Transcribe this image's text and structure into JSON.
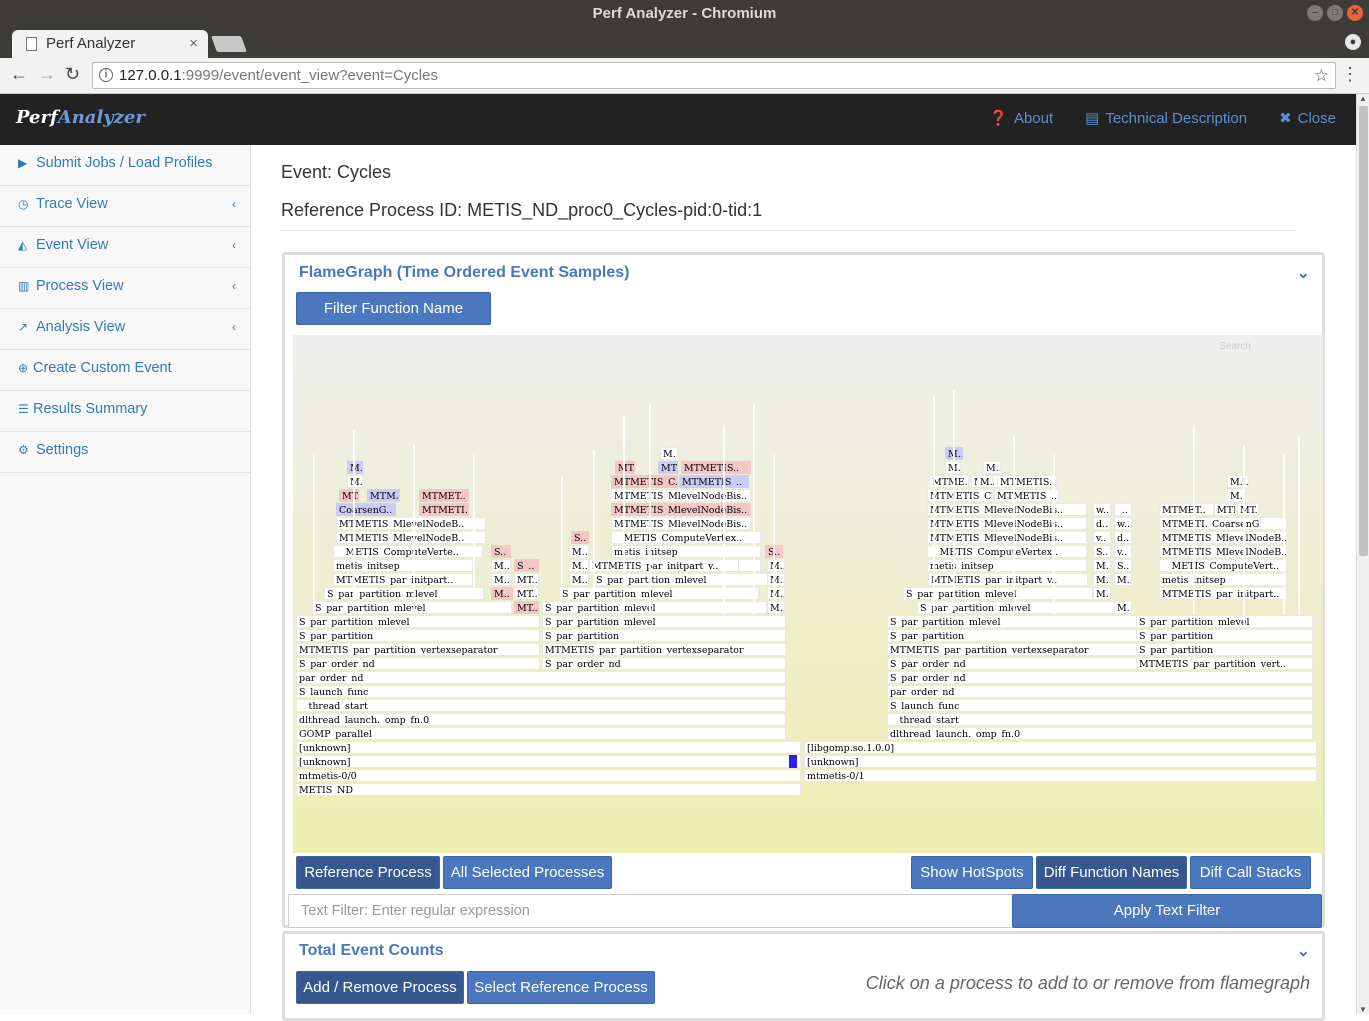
{
  "window": {
    "title": "Perf Analyzer - Chromium"
  },
  "browser": {
    "tab_title": "Perf Analyzer",
    "url_host": "127.0.0.1",
    "url_rest": ":9999/event/event_view?event=Cycles"
  },
  "navbar": {
    "brand_part1": "Perf",
    "brand_part2": "Analyzer",
    "about": "About",
    "tech": "Technical Description",
    "close": "Close"
  },
  "sidebar": {
    "items": [
      {
        "label": "Submit Jobs / Load Profiles",
        "icon": "play-icon"
      },
      {
        "label": "Trace View",
        "icon": "clock-icon"
      },
      {
        "label": "Event View",
        "icon": "area-chart-icon"
      },
      {
        "label": "Process View",
        "icon": "bar-chart-icon"
      },
      {
        "label": "Analysis View",
        "icon": "line-chart-icon"
      },
      {
        "label": "Create Custom Event",
        "icon": "plus-circle-icon"
      },
      {
        "label": "Results Summary",
        "icon": "list-icon"
      },
      {
        "label": "Settings",
        "icon": "gear-icon"
      }
    ]
  },
  "main": {
    "event_title": "Event: Cycles",
    "ref_title": "Reference Process ID: METIS_ND_proc0_Cycles-pid:0-tid:1"
  },
  "flame_panel": {
    "title": "FlameGraph (Time Ordered Event Samples)",
    "filter_button": "Filter Function Name",
    "search_label": "Search",
    "ref_button": "Reference Process",
    "all_button": "All Selected Processes",
    "hotspots_button": "Show HotSpots",
    "diff_names_button": "Diff Function Names",
    "diff_stacks_button": "Diff Call Stacks",
    "text_filter_placeholder": "Text Filter: Enter regular expression",
    "apply_button": "Apply Text Filter"
  },
  "counts_panel": {
    "title": "Total Event Counts",
    "add_button": "Add / Remove Process",
    "select_button": "Select Reference Process",
    "hint": "Click on a process to add to or remove from flamegraph"
  },
  "flame_frames": [
    {
      "t": "METIS_ND",
      "c": "w"
    },
    {
      "t": "mtmetis-0/0",
      "c": "w"
    },
    {
      "t": "mtmetis-0/1",
      "c": "w"
    },
    {
      "t": "[unknown]",
      "c": "w"
    },
    {
      "t": "[unknown]",
      "c": "w"
    },
    {
      "t": "[unknown]",
      "c": "w"
    },
    {
      "t": "[libgomp.so.1.0.0]",
      "c": "w"
    },
    {
      "t": "GOMP_parallel",
      "c": "w"
    },
    {
      "t": "dlthread_launch._omp_fn.0",
      "c": "w"
    },
    {
      "t": "dlthread_launch._omp_fn.0",
      "c": "w"
    },
    {
      "t": "__thread_start",
      "c": "w"
    },
    {
      "t": "__thread_start",
      "c": "w"
    },
    {
      "t": "S_launch_func",
      "c": "w"
    },
    {
      "t": "S_launch_func",
      "c": "w"
    },
    {
      "t": "par_order_nd",
      "c": "w"
    },
    {
      "t": "S_par_order_nd",
      "c": "w"
    },
    {
      "t": "S_par_order_nd",
      "c": "w"
    },
    {
      "t": "S_par_order_nd",
      "c": "w"
    },
    {
      "t": "S_par_order_nd",
      "c": "w"
    },
    {
      "t": "par_order_nd",
      "c": "w"
    },
    {
      "t": "MTMETIS_par_partition_vertexseparator",
      "c": "w"
    },
    {
      "t": "MTMETIS_par_partition_vertexseparator",
      "c": "w"
    },
    {
      "t": "MTMETIS_par_partition_vertexseparator",
      "c": "w"
    },
    {
      "t": "MTMETIS_par_partition_vert..",
      "c": "w"
    },
    {
      "t": "S_par_partition",
      "c": "w"
    },
    {
      "t": "S_par_partition",
      "c": "w"
    },
    {
      "t": "S_par_partition",
      "c": "w"
    },
    {
      "t": "S_par_partition",
      "c": "w"
    },
    {
      "t": "S_par_partition_mlevel",
      "c": "w"
    },
    {
      "t": "S_par_partition",
      "c": "w"
    },
    {
      "t": "S_par_partition_mlevel",
      "c": "w"
    },
    {
      "t": "S_par_partition_mlevel",
      "c": "w"
    },
    {
      "t": "S_par_partition_mlevel",
      "c": "w"
    },
    {
      "t": "MT..",
      "c": "p"
    },
    {
      "t": "S_par_partition_mlevel",
      "c": "w"
    },
    {
      "t": "S_par_partition_mlevel",
      "c": "w"
    },
    {
      "t": "M..",
      "c": "w"
    },
    {
      "t": "S_par_partition_mlevel",
      "c": "w"
    },
    {
      "t": "S_par_partition_mlevel",
      "c": "w"
    },
    {
      "t": "M..",
      "c": "p"
    },
    {
      "t": "MT..",
      "c": "w"
    },
    {
      "t": "S_par_partition_mlevel",
      "c": "w"
    },
    {
      "t": "M..",
      "c": "w"
    },
    {
      "t": "S_par_partition_mlevel",
      "c": "w"
    },
    {
      "t": "M..",
      "c": "w"
    },
    {
      "t": "M..",
      "c": "w"
    },
    {
      "t": "MTMETIS_par_initpart..",
      "c": "w"
    },
    {
      "t": "M..",
      "c": "w"
    },
    {
      "t": "MT..",
      "c": "w"
    },
    {
      "t": "M..",
      "c": "w"
    },
    {
      "t": "S_par_partition_mlevel",
      "c": "w"
    },
    {
      "t": "M..",
      "c": "w"
    },
    {
      "t": "M..",
      "c": "w"
    },
    {
      "t": "MTMETIS_par_initpart_v..",
      "c": "w"
    },
    {
      "t": "M..",
      "c": "w"
    },
    {
      "t": "MTMETIS_par_initpart..",
      "c": "w"
    },
    {
      "t": "metis_initsep",
      "c": "w"
    },
    {
      "t": "M..",
      "c": "w"
    },
    {
      "t": "S_..",
      "c": "p"
    },
    {
      "t": "M..",
      "c": "w"
    },
    {
      "t": "metis_initsep",
      "c": "w"
    },
    {
      "t": "MTMETIS_par_initpart_v..",
      "c": "w"
    },
    {
      "t": "M..",
      "c": "w"
    },
    {
      "t": "metis_initsep",
      "c": "w"
    },
    {
      "t": "M..",
      "c": "w"
    },
    {
      "t": "S..",
      "c": "w"
    },
    {
      "t": "metis_initsep",
      "c": "w"
    },
    {
      "t": "__METIS_ComputeVerte..",
      "c": "w"
    },
    {
      "t": "S..",
      "c": "p"
    },
    {
      "t": "M..",
      "c": "w"
    },
    {
      "t": "metis_initsep",
      "c": "w"
    },
    {
      "t": "S..",
      "c": "p"
    },
    {
      "t": "__METIS_ComputeVertex..",
      "c": "w"
    },
    {
      "t": "S..",
      "c": "w"
    },
    {
      "t": "v..",
      "c": "w"
    },
    {
      "t": "__METIS_ComputeVert..",
      "c": "w"
    },
    {
      "t": "MTMETIS_MlevelNodeB..",
      "c": "w"
    },
    {
      "t": "S..",
      "c": "p"
    },
    {
      "t": "__METIS_ComputeVertex..",
      "c": "w"
    },
    {
      "t": "MTMETIS_MlevelNodeBis..",
      "c": "w"
    },
    {
      "t": "v..",
      "c": "w"
    },
    {
      "t": "d..",
      "c": "w"
    },
    {
      "t": "MTMETIS_MlevelNodeB..",
      "c": "w"
    },
    {
      "t": "MTMETIS_MlevelNodeB..",
      "c": "w"
    },
    {
      "t": "MTMETIS_MlevelNodeBis..",
      "c": "w"
    },
    {
      "t": "MTMETIS_MlevelNodeBis..",
      "c": "w"
    },
    {
      "t": "d..",
      "c": "w"
    },
    {
      "t": "w..",
      "c": "w"
    },
    {
      "t": "MTMETIS_MlevelNodeB..",
      "c": "w"
    },
    {
      "t": "CoarsenG..",
      "c": "l"
    },
    {
      "t": "MTMETI..",
      "c": "p"
    },
    {
      "t": "MTMETIS_MlevelNodeBis..",
      "c": "p"
    },
    {
      "t": "MTMETIS_MlevelNodeBis..",
      "c": "w"
    },
    {
      "t": "w..",
      "c": "w"
    },
    {
      "t": "_..",
      "c": "w"
    },
    {
      "t": "MTMET..",
      "c": "w"
    },
    {
      "t": "MTM..",
      "c": "w"
    },
    {
      "t": "MT..",
      "c": "w"
    },
    {
      "t": "MT..",
      "c": "p"
    },
    {
      "t": "MTM..",
      "c": "l"
    },
    {
      "t": "MTMET..",
      "c": "p"
    },
    {
      "t": "MTMETIS_MlevelNodeBis..",
      "c": "w"
    },
    {
      "t": "MTMETIS_C..",
      "c": "w"
    },
    {
      "t": "MTMETIS_..",
      "c": "w"
    },
    {
      "t": "MTMETI..",
      "c": "w"
    },
    {
      "t": "CoarsenG..",
      "c": "w"
    },
    {
      "t": "M..",
      "c": "w"
    },
    {
      "t": "MTMETIS_C..",
      "c": "p"
    },
    {
      "t": "MTMETIS_..",
      "c": "l"
    },
    {
      "t": "MTME..",
      "c": "w"
    },
    {
      "t": "MT..",
      "c": "w"
    },
    {
      "t": "MTMETIS..",
      "c": "w"
    },
    {
      "t": "M..",
      "c": "w"
    },
    {
      "t": "M..",
      "c": "l"
    },
    {
      "t": "MT..",
      "c": "p"
    },
    {
      "t": "MTME..",
      "c": "l"
    },
    {
      "t": "MTMETIS..",
      "c": "p"
    },
    {
      "t": "M..",
      "c": "w"
    },
    {
      "t": "M..",
      "c": "w"
    },
    {
      "t": "M..",
      "c": "w"
    },
    {
      "t": "M..",
      "c": "w"
    },
    {
      "t": "M..",
      "c": "w"
    },
    {
      "t": "M..",
      "c": "l"
    },
    {
      "t": "M..",
      "c": "w"
    }
  ]
}
